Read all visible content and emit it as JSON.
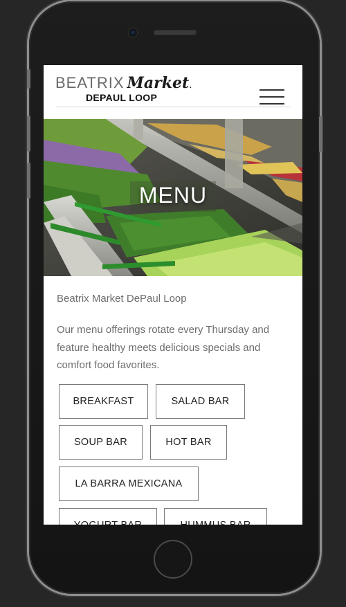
{
  "brand": {
    "name_light": "BEATRIX",
    "name_script": "Market",
    "location": "DEPAUL LOOP"
  },
  "nav": {
    "menu_icon": "hamburger-menu-icon"
  },
  "hero": {
    "title": "MENU"
  },
  "content": {
    "subtitle": "Beatrix Market DePaul Loop",
    "description": "Our menu offerings rotate every Thursday and feature healthy meets delicious specials and comfort food favorites."
  },
  "menu_buttons": [
    "BREAKFAST",
    "SALAD BAR",
    "SOUP BAR",
    "HOT BAR",
    "LA BARRA MEXICANA",
    "YOGURT BAR",
    "HUMMUS BAR"
  ],
  "colors": {
    "background": "#262626",
    "text_gray": "#6d6d6d",
    "button_border": "#7a7a7a"
  }
}
